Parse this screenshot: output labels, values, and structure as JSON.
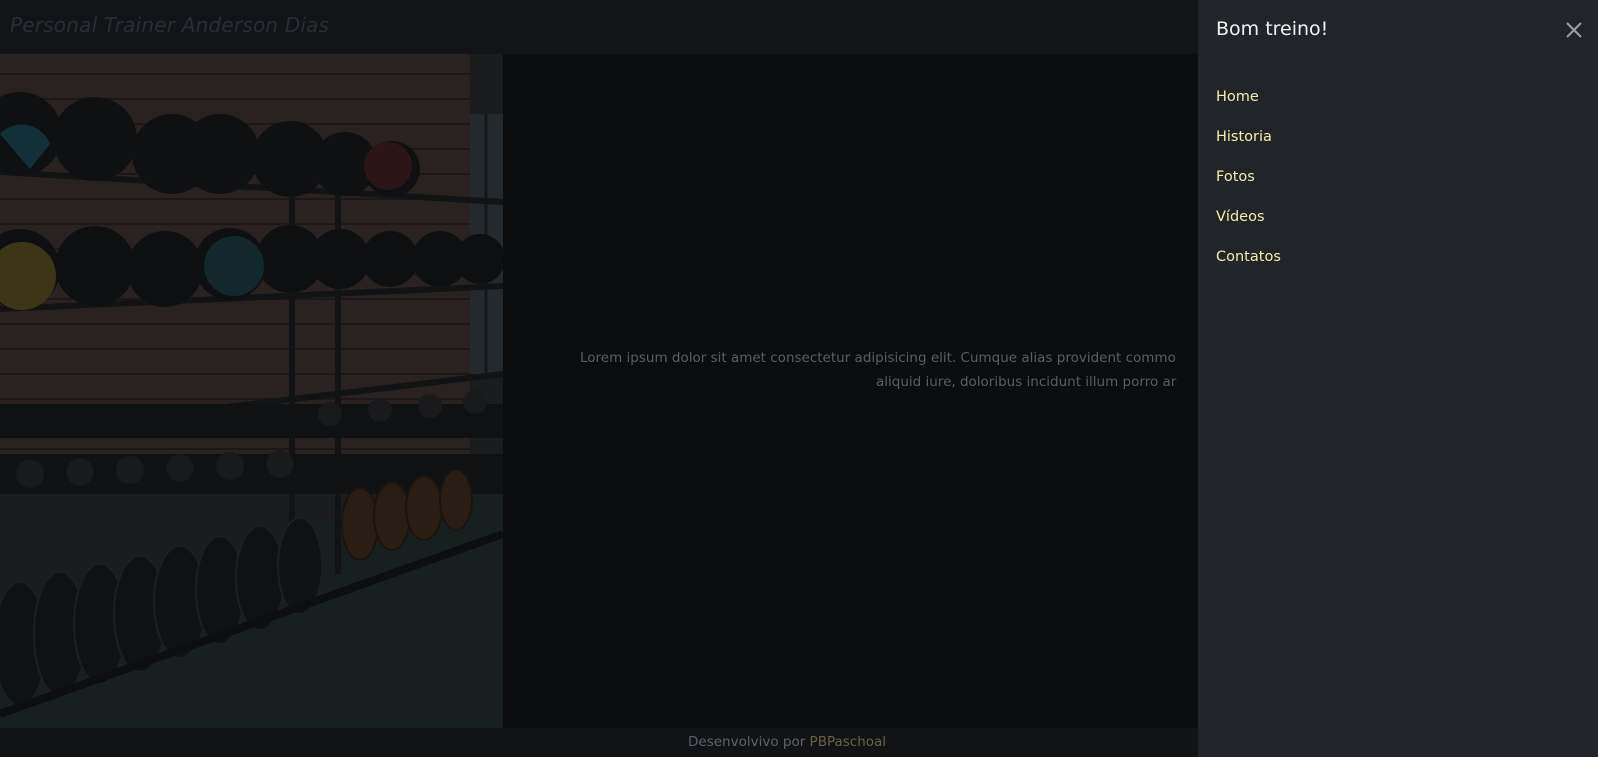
{
  "header": {
    "brand": "Personal Trainer Anderson Dias"
  },
  "hero": {
    "text_line1": "Lorem ipsum dolor sit amet consectetur adipisicing elit. Cumque alias provident commo",
    "text_line2": "aliquid iure, doloribus incidunt illum porro ar"
  },
  "footer": {
    "prefix": "Desenvolvivo por ",
    "author": "PBPaschoal"
  },
  "drawer": {
    "title": "Bom treino!",
    "close_icon": "close-icon",
    "nav": [
      {
        "label": "Home"
      },
      {
        "label": "Historia"
      },
      {
        "label": "Fotos"
      },
      {
        "label": "Vídeos"
      },
      {
        "label": "Contatos"
      }
    ]
  },
  "colors": {
    "drawer_bg": "#212529",
    "nav_link": "#f5ecae",
    "backdrop": "#0b0c0e"
  }
}
